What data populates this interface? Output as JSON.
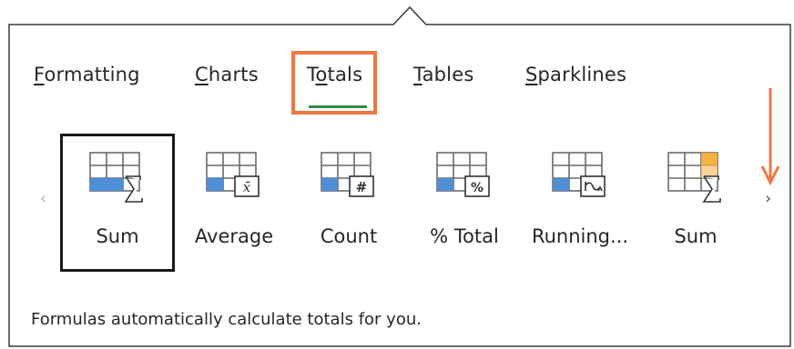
{
  "tabs": [
    {
      "label": "Formatting",
      "accel_index": 0
    },
    {
      "label": "Charts",
      "accel_index": 0
    },
    {
      "label": "Totals",
      "accel_index": 1
    },
    {
      "label": "Tables",
      "accel_index": 0
    },
    {
      "label": "Sparklines",
      "accel_index": 0
    }
  ],
  "selected_tab": "Totals",
  "items": [
    {
      "label": "Sum",
      "icon": "sum-icon",
      "selected": true
    },
    {
      "label": "Average",
      "icon": "average-icon",
      "selected": false
    },
    {
      "label": "Count",
      "icon": "count-icon",
      "selected": false
    },
    {
      "label": "% Total",
      "icon": "percent-total-icon",
      "selected": false
    },
    {
      "label": "Running...",
      "icon": "running-total-icon",
      "selected": false
    },
    {
      "label": "Sum",
      "icon": "sum-column-icon",
      "selected": false
    }
  ],
  "nav": {
    "prev_glyph": "‹",
    "next_glyph": "›"
  },
  "hint": "Formulas automatically calculate totals for you.",
  "colors": {
    "highlight": "#ee7840",
    "tab_underline": "#2d8a46",
    "cell_blue": "#4f8fd6",
    "cell_orange": "#f5a623"
  }
}
